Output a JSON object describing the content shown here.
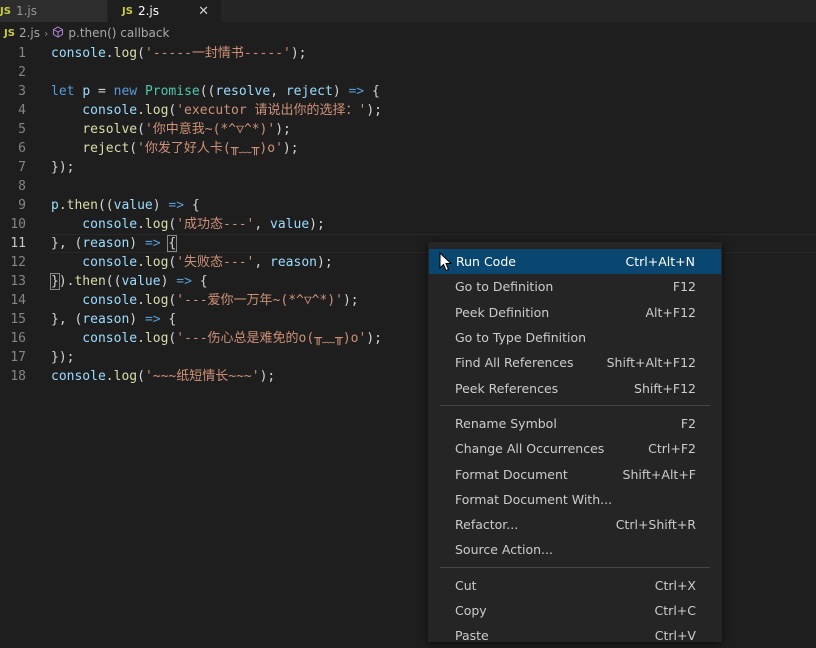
{
  "tabs": [
    {
      "icon": "JS",
      "label": "1.js",
      "active": false
    },
    {
      "icon": "JS",
      "label": "2.js",
      "active": true,
      "close": "✕"
    }
  ],
  "breadcrumb": {
    "file_icon": "JS",
    "file": "2.js",
    "separator": "›",
    "symbol": "p.then() callback"
  },
  "editor": {
    "current_line": 11,
    "lines": [
      {
        "n": "1",
        "tokens": [
          [
            "console",
            "var"
          ],
          [
            ".",
            "p"
          ],
          [
            "log",
            "fn"
          ],
          [
            "(",
            "p"
          ],
          [
            "'-----一封情书-----'",
            "str"
          ],
          [
            ");",
            "p"
          ]
        ]
      },
      {
        "n": "2",
        "tokens": []
      },
      {
        "n": "3",
        "tokens": [
          [
            "let ",
            "kw"
          ],
          [
            "p",
            "var"
          ],
          [
            " = ",
            "p"
          ],
          [
            "new ",
            "kw"
          ],
          [
            "Promise",
            "cls"
          ],
          [
            "((",
            "p"
          ],
          [
            "resolve",
            "var"
          ],
          [
            ", ",
            "p"
          ],
          [
            "reject",
            "var"
          ],
          [
            ") ",
            "p"
          ],
          [
            "=>",
            "kw"
          ],
          [
            " {",
            "p"
          ]
        ]
      },
      {
        "n": "4",
        "tokens": [
          [
            "    console",
            "var"
          ],
          [
            ".",
            "p"
          ],
          [
            "log",
            "fn"
          ],
          [
            "(",
            "p"
          ],
          [
            "'executor 请说出你的选择：'",
            "str"
          ],
          [
            ");",
            "p"
          ]
        ]
      },
      {
        "n": "5",
        "tokens": [
          [
            "    ",
            "p"
          ],
          [
            "resolve",
            "fn"
          ],
          [
            "(",
            "p"
          ],
          [
            "'你中意我~(*^▽^*)'",
            "str"
          ],
          [
            ");",
            "p"
          ]
        ]
      },
      {
        "n": "6",
        "tokens": [
          [
            "    ",
            "p"
          ],
          [
            "reject",
            "fn"
          ],
          [
            "(",
            "p"
          ],
          [
            "'你发了好人卡(╥﹏╥)o'",
            "str"
          ],
          [
            ");",
            "p"
          ]
        ]
      },
      {
        "n": "7",
        "tokens": [
          [
            "});",
            "p"
          ]
        ]
      },
      {
        "n": "8",
        "tokens": []
      },
      {
        "n": "9",
        "tokens": [
          [
            "p",
            "var"
          ],
          [
            ".",
            "p"
          ],
          [
            "then",
            "fn"
          ],
          [
            "((",
            "p"
          ],
          [
            "value",
            "var"
          ],
          [
            ") ",
            "p"
          ],
          [
            "=>",
            "kw"
          ],
          [
            " {",
            "p"
          ]
        ]
      },
      {
        "n": "10",
        "tokens": [
          [
            "    console",
            "var"
          ],
          [
            ".",
            "p"
          ],
          [
            "log",
            "fn"
          ],
          [
            "(",
            "p"
          ],
          [
            "'成功态---'",
            "str"
          ],
          [
            ", ",
            "p"
          ],
          [
            "value",
            "var"
          ],
          [
            ");",
            "p"
          ]
        ]
      },
      {
        "n": "11",
        "tokens": [
          [
            "}, (",
            "p"
          ],
          [
            "reason",
            "var"
          ],
          [
            ") ",
            "p"
          ],
          [
            "=>",
            "kw"
          ],
          [
            " ",
            "p"
          ],
          [
            "{",
            "bm"
          ]
        ]
      },
      {
        "n": "12",
        "tokens": [
          [
            "    console",
            "var"
          ],
          [
            ".",
            "p"
          ],
          [
            "log",
            "fn"
          ],
          [
            "(",
            "p"
          ],
          [
            "'失败态---'",
            "str"
          ],
          [
            ", ",
            "p"
          ],
          [
            "reason",
            "var"
          ],
          [
            ");",
            "p"
          ]
        ]
      },
      {
        "n": "13",
        "tokens": [
          [
            "}",
            "bm"
          ],
          [
            ").",
            "p"
          ],
          [
            "then",
            "fn"
          ],
          [
            "((",
            "p"
          ],
          [
            "value",
            "var"
          ],
          [
            ") ",
            "p"
          ],
          [
            "=>",
            "kw"
          ],
          [
            " {",
            "p"
          ]
        ]
      },
      {
        "n": "14",
        "tokens": [
          [
            "    console",
            "var"
          ],
          [
            ".",
            "p"
          ],
          [
            "log",
            "fn"
          ],
          [
            "(",
            "p"
          ],
          [
            "'---爱你一万年~(*^▽^*)'",
            "str"
          ],
          [
            ");",
            "p"
          ]
        ]
      },
      {
        "n": "15",
        "tokens": [
          [
            "}, (",
            "p"
          ],
          [
            "reason",
            "var"
          ],
          [
            ") ",
            "p"
          ],
          [
            "=>",
            "kw"
          ],
          [
            " {",
            "p"
          ]
        ]
      },
      {
        "n": "16",
        "tokens": [
          [
            "    console",
            "var"
          ],
          [
            ".",
            "p"
          ],
          [
            "log",
            "fn"
          ],
          [
            "(",
            "p"
          ],
          [
            "'---伤心总是难免的o(╥﹏╥)o'",
            "str"
          ],
          [
            ");",
            "p"
          ]
        ]
      },
      {
        "n": "17",
        "tokens": [
          [
            "});",
            "p"
          ]
        ]
      },
      {
        "n": "18",
        "tokens": [
          [
            "console",
            "var"
          ],
          [
            ".",
            "p"
          ],
          [
            "log",
            "fn"
          ],
          [
            "(",
            "p"
          ],
          [
            "'~~~纸短情长~~~'",
            "str"
          ],
          [
            ");",
            "p"
          ]
        ]
      }
    ]
  },
  "context_menu": {
    "groups": [
      [
        {
          "label": "Run Code",
          "key": "Ctrl+Alt+N",
          "active": true
        },
        {
          "label": "Go to Definition",
          "key": "F12"
        },
        {
          "label": "Peek Definition",
          "key": "Alt+F12"
        },
        {
          "label": "Go to Type Definition",
          "key": ""
        },
        {
          "label": "Find All References",
          "key": "Shift+Alt+F12"
        },
        {
          "label": "Peek References",
          "key": "Shift+F12"
        }
      ],
      [
        {
          "label": "Rename Symbol",
          "key": "F2"
        },
        {
          "label": "Change All Occurrences",
          "key": "Ctrl+F2"
        },
        {
          "label": "Format Document",
          "key": "Shift+Alt+F"
        },
        {
          "label": "Format Document With...",
          "key": ""
        },
        {
          "label": "Refactor...",
          "key": "Ctrl+Shift+R"
        },
        {
          "label": "Source Action...",
          "key": ""
        }
      ],
      [
        {
          "label": "Cut",
          "key": "Ctrl+X"
        },
        {
          "label": "Copy",
          "key": "Ctrl+C"
        },
        {
          "label": "Paste",
          "key": "Ctrl+V"
        }
      ]
    ]
  },
  "colors": {
    "editor_bg": "#1e1e1e",
    "menu_bg": "#252526",
    "menu_highlight": "#094771",
    "string": "#ce9178",
    "keyword": "#569cd6",
    "variable": "#9cdcfe",
    "function": "#dcdcaa",
    "class": "#4ec9b0"
  }
}
